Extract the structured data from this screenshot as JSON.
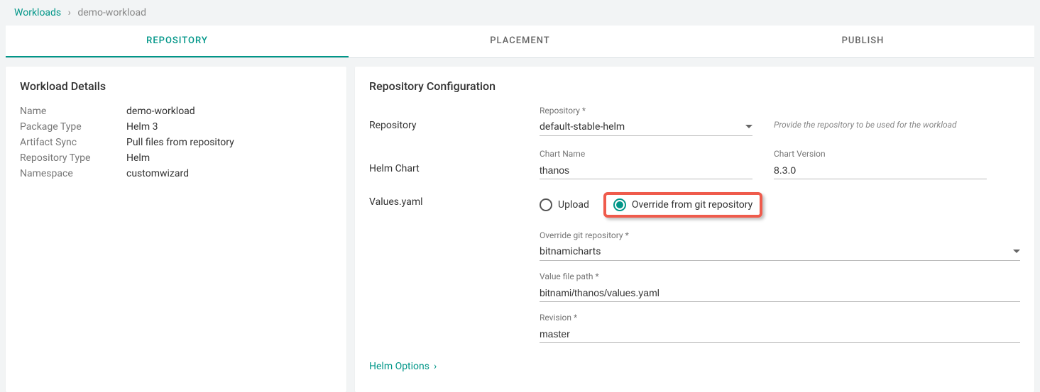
{
  "breadcrumb": {
    "root": "Workloads",
    "current": "demo-workload"
  },
  "tabs": {
    "repository": "REPOSITORY",
    "placement": "PLACEMENT",
    "publish": "PUBLISH"
  },
  "details": {
    "title": "Workload Details",
    "name_label": "Name",
    "name_value": "demo-workload",
    "package_type_label": "Package Type",
    "package_type_value": "Helm 3",
    "artifact_sync_label": "Artifact Sync",
    "artifact_sync_value": "Pull files from repository",
    "repo_type_label": "Repository Type",
    "repo_type_value": "Helm",
    "namespace_label": "Namespace",
    "namespace_value": "customwizard"
  },
  "config": {
    "title": "Repository Configuration",
    "repository_row_label": "Repository",
    "repository_field_label": "Repository *",
    "repository_value": "default-stable-helm",
    "repository_hint": "Provide the repository to be used for the workload",
    "helm_chart_row_label": "Helm Chart",
    "chart_name_label": "Chart Name",
    "chart_name_value": "thanos",
    "chart_version_label": "Chart Version",
    "chart_version_value": "8.3.0",
    "values_row_label": "Values.yaml",
    "upload_option": "Upload",
    "override_option": "Override from git repository",
    "override_repo_label": "Override git repository *",
    "override_repo_value": "bitnamicharts",
    "value_path_label": "Value file path *",
    "value_path_value": "bitnami/thanos/values.yaml",
    "revision_label": "Revision *",
    "revision_value": "master",
    "helm_options": "Helm Options"
  }
}
